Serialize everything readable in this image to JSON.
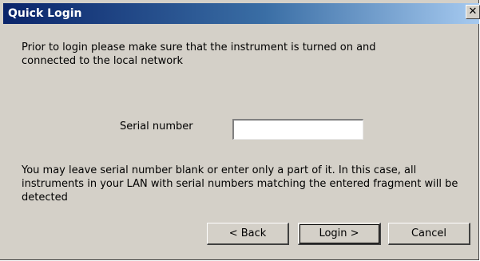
{
  "window": {
    "title": "Quick Login",
    "close_glyph": "✕"
  },
  "intro_text": "Prior to login please make sure that the instrument is turned on and connected to the local network",
  "serial": {
    "label": "Serial number",
    "value": ""
  },
  "hint_text": "You may leave serial number blank or enter only a part of it. In this case, all instruments in your LAN with serial numbers matching the entered fragment will be detected",
  "buttons": {
    "back": "< Back",
    "login": "Login >",
    "cancel": "Cancel"
  },
  "colors": {
    "title_bar_start": "#0a246a",
    "dialog_background": "#d4d0c8"
  }
}
